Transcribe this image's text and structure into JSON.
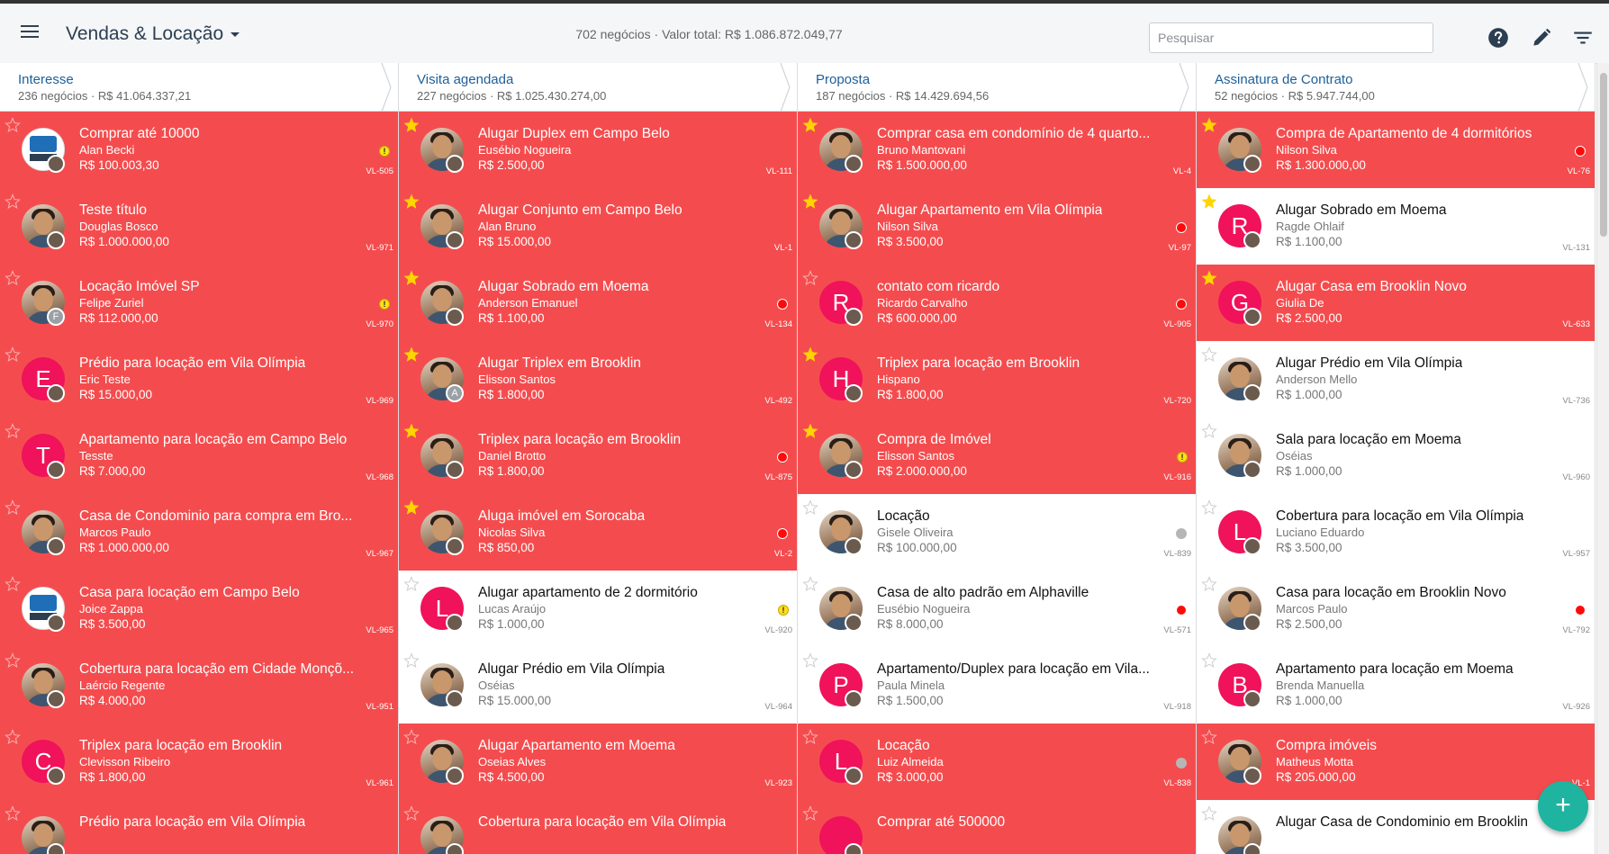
{
  "header": {
    "title": "Vendas & Locação",
    "summary": "702 negócios · Valor total: R$ 1.086.872.049,77",
    "search_placeholder": "Pesquisar",
    "icons": [
      "menu-icon",
      "caret-down-icon",
      "help-icon",
      "edit-pencil-icon",
      "filter-icon"
    ]
  },
  "colors": {
    "card_highlight": "#f44c4e",
    "letter_avatar": "#f0125a",
    "column_title": "#1e5f99",
    "fab": "#1fb4a0",
    "star_active": "#ffd400"
  },
  "fab_label": "+",
  "columns": [
    {
      "title": "Interesse",
      "subtitle": "236 negócios · R$ 41.064.337,21",
      "cards": [
        {
          "title": "Comprar até 10000",
          "name": "Alan Becki",
          "value": "R$ 100.003,30",
          "code": "VL-505",
          "red": true,
          "starred": false,
          "avatar": "logo",
          "indicator": "warning"
        },
        {
          "title": "Teste título",
          "name": "Douglas Bosco",
          "value": "R$ 1.000.000,00",
          "code": "VL-971",
          "red": true,
          "starred": false,
          "avatar": "photo",
          "indicator": "none"
        },
        {
          "title": "Locação Imóvel SP",
          "name": "Felipe Zuriel",
          "value": "R$ 112.000,00",
          "code": "VL-970",
          "red": true,
          "starred": false,
          "avatar": "photo",
          "mini_letter": "F",
          "indicator": "warning"
        },
        {
          "title": "Prédio para locação em Vila Olímpia",
          "name": "Eric Teste",
          "value": "R$ 15.000,00",
          "code": "VL-969",
          "red": true,
          "starred": false,
          "avatar": "letter",
          "letter": "E",
          "indicator": "none"
        },
        {
          "title": "Apartamento para locação em Campo Belo",
          "name": "Tesste",
          "value": "R$ 7.000,00",
          "code": "VL-968",
          "red": true,
          "starred": false,
          "avatar": "letter",
          "letter": "T",
          "indicator": "none"
        },
        {
          "title": "Casa de Condominio para compra em Bro...",
          "name": "Marcos Paulo",
          "value": "R$ 1.000.000,00",
          "code": "VL-967",
          "red": true,
          "starred": false,
          "avatar": "photo",
          "indicator": "none"
        },
        {
          "title": "Casa para locação em Campo Belo",
          "name": "Joice Zappa",
          "value": "R$ 3.500,00",
          "code": "VL-965",
          "red": true,
          "starred": false,
          "avatar": "logo",
          "indicator": "none"
        },
        {
          "title": "Cobertura para locação em Cidade Monçõ...",
          "name": "Laércio Regente",
          "value": "R$ 4.000,00",
          "code": "VL-951",
          "red": true,
          "starred": false,
          "avatar": "photo",
          "indicator": "none"
        },
        {
          "title": "Triplex para locação em Brooklin",
          "name": "Clevisson Ribeiro",
          "value": "R$ 1.800,00",
          "code": "VL-961",
          "red": true,
          "starred": false,
          "avatar": "letter",
          "letter": "C",
          "indicator": "none"
        },
        {
          "title": "Prédio para locação em Vila Olímpia",
          "name": "",
          "value": "",
          "code": "",
          "red": true,
          "starred": false,
          "avatar": "photo",
          "indicator": "none"
        }
      ]
    },
    {
      "title": "Visita agendada",
      "subtitle": "227 negócios · R$ 1.025.430.274,00",
      "cards": [
        {
          "title": "Alugar Duplex em Campo Belo",
          "name": "Eusébio Nogueira",
          "value": "R$ 2.500,00",
          "code": "VL-111",
          "red": true,
          "starred": true,
          "avatar": "photo",
          "indicator": "none"
        },
        {
          "title": "Alugar Conjunto em Campo Belo",
          "name": "Alan Bruno",
          "value": "R$ 15.000,00",
          "code": "VL-1",
          "red": true,
          "starred": true,
          "avatar": "photo",
          "indicator": "none"
        },
        {
          "title": "Alugar Sobrado em Moema",
          "name": "Anderson Emanuel",
          "value": "R$ 1.100,00",
          "code": "VL-134",
          "red": true,
          "starred": true,
          "avatar": "photo",
          "indicator": "red"
        },
        {
          "title": "Alugar Triplex em Brooklin",
          "name": "Elisson Santos",
          "value": "R$ 1.800,00",
          "code": "VL-492",
          "red": true,
          "starred": true,
          "avatar": "photo",
          "mini_letter": "A",
          "indicator": "none"
        },
        {
          "title": "Triplex para locação em Brooklin",
          "name": "Daniel Brotto",
          "value": "R$ 1.800,00",
          "code": "VL-875",
          "red": true,
          "starred": true,
          "avatar": "photo",
          "indicator": "red"
        },
        {
          "title": "Aluga imóvel em Sorocaba",
          "name": "Nicolas Silva",
          "value": "R$ 850,00",
          "code": "VL-2",
          "red": true,
          "starred": true,
          "avatar": "photo",
          "indicator": "red"
        },
        {
          "title": "Alugar apartamento de 2 dormitório",
          "name": "Lucas Araújo",
          "value": "R$ 1.000,00",
          "code": "VL-920",
          "red": false,
          "starred": false,
          "avatar": "letter",
          "letter": "L",
          "indicator": "warning"
        },
        {
          "title": "Alugar Prédio em Vila Olímpia",
          "name": "Oséias",
          "value": "R$ 15.000,00",
          "code": "VL-964",
          "red": false,
          "starred": false,
          "avatar": "photo",
          "indicator": "none"
        },
        {
          "title": "Alugar Apartamento em Moema",
          "name": "Oseias Alves",
          "value": "R$ 4.500,00",
          "code": "VL-923",
          "red": true,
          "starred": false,
          "avatar": "photo",
          "indicator": "none"
        },
        {
          "title": "Cobertura para locação em Vila Olímpia",
          "name": "",
          "value": "",
          "code": "",
          "red": true,
          "starred": false,
          "avatar": "photo",
          "indicator": "none"
        }
      ]
    },
    {
      "title": "Proposta",
      "subtitle": "187 negócios · R$ 14.429.694,56",
      "cards": [
        {
          "title": "Comprar casa em condomínio de 4 quarto...",
          "name": "Bruno Mantovani",
          "value": "R$ 1.500.000,00",
          "code": "VL-4",
          "red": true,
          "starred": true,
          "avatar": "photo",
          "indicator": "none"
        },
        {
          "title": "Alugar Apartamento em Vila Olímpia",
          "name": "Nilson Silva",
          "value": "R$ 3.500,00",
          "code": "VL-97",
          "red": true,
          "starred": true,
          "avatar": "photo",
          "indicator": "red"
        },
        {
          "title": "contato com ricardo",
          "name": "Ricardo Carvalho",
          "value": "R$ 600.000,00",
          "code": "VL-905",
          "red": true,
          "starred": false,
          "avatar": "letter",
          "letter": "R",
          "indicator": "red"
        },
        {
          "title": "Triplex para locação em Brooklin",
          "name": "Hispano",
          "value": "R$ 1.800,00",
          "code": "VL-720",
          "red": true,
          "starred": true,
          "avatar": "letter",
          "letter": "H",
          "indicator": "none"
        },
        {
          "title": "Compra de Imóvel",
          "name": "Elisson Santos",
          "value": "R$ 2.000.000,00",
          "code": "VL-916",
          "red": true,
          "starred": true,
          "avatar": "photo",
          "indicator": "warning"
        },
        {
          "title": "Locação",
          "name": "Gisele Oliveira",
          "value": "R$ 100.000,00",
          "code": "VL-839",
          "red": false,
          "starred": false,
          "avatar": "photo",
          "indicator": "grey"
        },
        {
          "title": "Casa de alto padrão em Alphaville",
          "name": "Eusébio Nogueira",
          "value": "R$ 8.000,00",
          "code": "VL-571",
          "red": false,
          "starred": false,
          "avatar": "photo",
          "indicator": "red"
        },
        {
          "title": "Apartamento/Duplex para locação em Vila...",
          "name": "Paula Minela",
          "value": "R$ 1.500,00",
          "code": "VL-918",
          "red": false,
          "starred": false,
          "avatar": "letter",
          "letter": "P",
          "indicator": "none"
        },
        {
          "title": "Locação",
          "name": "Luiz Almeida",
          "value": "R$ 3.000,00",
          "code": "VL-838",
          "red": true,
          "starred": false,
          "avatar": "letter",
          "letter": "L",
          "indicator": "grey"
        },
        {
          "title": "Comprar até 500000",
          "name": "",
          "value": "",
          "code": "",
          "red": true,
          "starred": false,
          "avatar": "letter",
          "letter": "",
          "indicator": "none"
        }
      ]
    },
    {
      "title": "Assinatura de Contrato",
      "subtitle": "52 negócios · R$ 5.947.744,00",
      "cards": [
        {
          "title": "Compra de Apartamento de 4 dormitórios",
          "name": "Nilson Silva",
          "value": "R$ 1.300.000,00",
          "code": "VL-76",
          "red": true,
          "starred": true,
          "avatar": "photo",
          "indicator": "red"
        },
        {
          "title": "Alugar Sobrado em Moema",
          "name": "Ragde Ohlaif",
          "value": "R$ 1.100,00",
          "code": "VL-131",
          "red": false,
          "starred": true,
          "avatar": "letter",
          "letter": "R",
          "indicator": "none"
        },
        {
          "title": "Alugar Casa em Brooklin Novo",
          "name": "Giulia De",
          "value": "R$ 2.500,00",
          "code": "VL-633",
          "red": true,
          "starred": true,
          "avatar": "letter",
          "letter": "G",
          "indicator": "none"
        },
        {
          "title": "Alugar Prédio em Vila Olímpia",
          "name": "Anderson Mello",
          "value": "R$ 1.000,00",
          "code": "VL-736",
          "red": false,
          "starred": false,
          "avatar": "photo",
          "indicator": "none"
        },
        {
          "title": "Sala para locação em Moema",
          "name": "Oséias",
          "value": "R$ 1.000,00",
          "code": "VL-960",
          "red": false,
          "starred": false,
          "avatar": "photo",
          "indicator": "none"
        },
        {
          "title": "Cobertura para locação em Vila Olímpia",
          "name": "Luciano Eduardo",
          "value": "R$ 3.500,00",
          "code": "VL-957",
          "red": false,
          "starred": false,
          "avatar": "letter",
          "letter": "L",
          "indicator": "none"
        },
        {
          "title": "Casa para locação em Brooklin Novo",
          "name": "Marcos Paulo",
          "value": "R$ 2.500,00",
          "code": "VL-792",
          "red": false,
          "starred": false,
          "avatar": "photo",
          "indicator": "red"
        },
        {
          "title": "Apartamento para locação em Moema",
          "name": "Brenda Manuella",
          "value": "R$ 1.000,00",
          "code": "VL-926",
          "red": false,
          "starred": false,
          "avatar": "letter",
          "letter": "B",
          "indicator": "none"
        },
        {
          "title": "Compra imóveis",
          "name": "Matheus Motta",
          "value": "R$ 205.000,00",
          "code": "VL-1",
          "red": true,
          "starred": false,
          "avatar": "photo",
          "indicator": "none"
        },
        {
          "title": "Alugar Casa de Condominio em Brooklin",
          "name": "",
          "value": "",
          "code": "",
          "red": false,
          "starred": false,
          "avatar": "photo",
          "indicator": "none"
        }
      ]
    }
  ]
}
